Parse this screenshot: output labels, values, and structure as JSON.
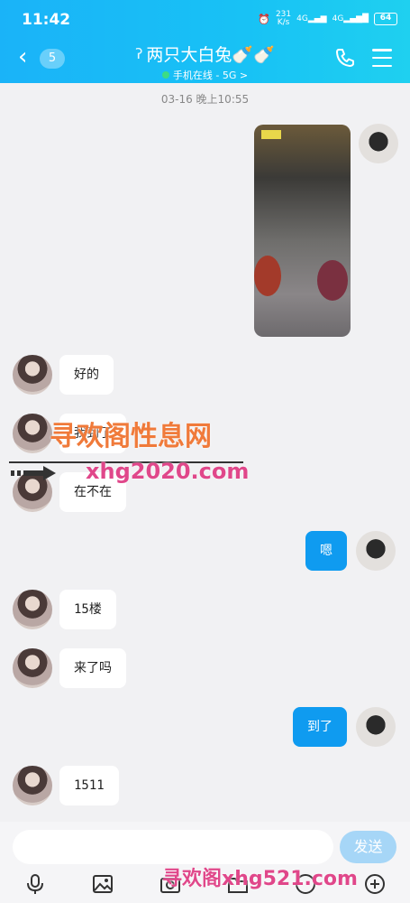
{
  "status_bar": {
    "time": "11:42",
    "net_speed": "231\nK/s",
    "signal": "4G",
    "battery": "64"
  },
  "header": {
    "unread_count": "5",
    "title": "两只大白兔🍼🍼",
    "subtitle": "手机在线 - 5G >"
  },
  "chat": {
    "timestamp": "03-16 晚上10:55",
    "messages": [
      {
        "side": "me",
        "type": "image"
      },
      {
        "side": "her",
        "text": "好的"
      },
      {
        "side": "her",
        "text": "我到了"
      },
      {
        "side": "her",
        "text": "在不在"
      },
      {
        "side": "me",
        "text": "嗯"
      },
      {
        "side": "her",
        "text": "15楼"
      },
      {
        "side": "her",
        "text": "来了吗"
      },
      {
        "side": "me",
        "text": "到了"
      },
      {
        "side": "her",
        "text": "1511"
      }
    ]
  },
  "watermark": {
    "line1": "寻欢阁性息网",
    "line2": "xhg2020.com",
    "line3": "寻欢阁xhg521.com"
  },
  "input_bar": {
    "placeholder": "",
    "send_label": "发送"
  },
  "toolbar": {
    "icons": [
      "microphone-icon",
      "image-icon",
      "camera-icon",
      "folder-icon",
      "emoji-icon",
      "plus-icon"
    ]
  },
  "colors": {
    "accent": "#0f9bf0",
    "header": "#18c2f5",
    "send_disabled": "#a6d6f7"
  }
}
